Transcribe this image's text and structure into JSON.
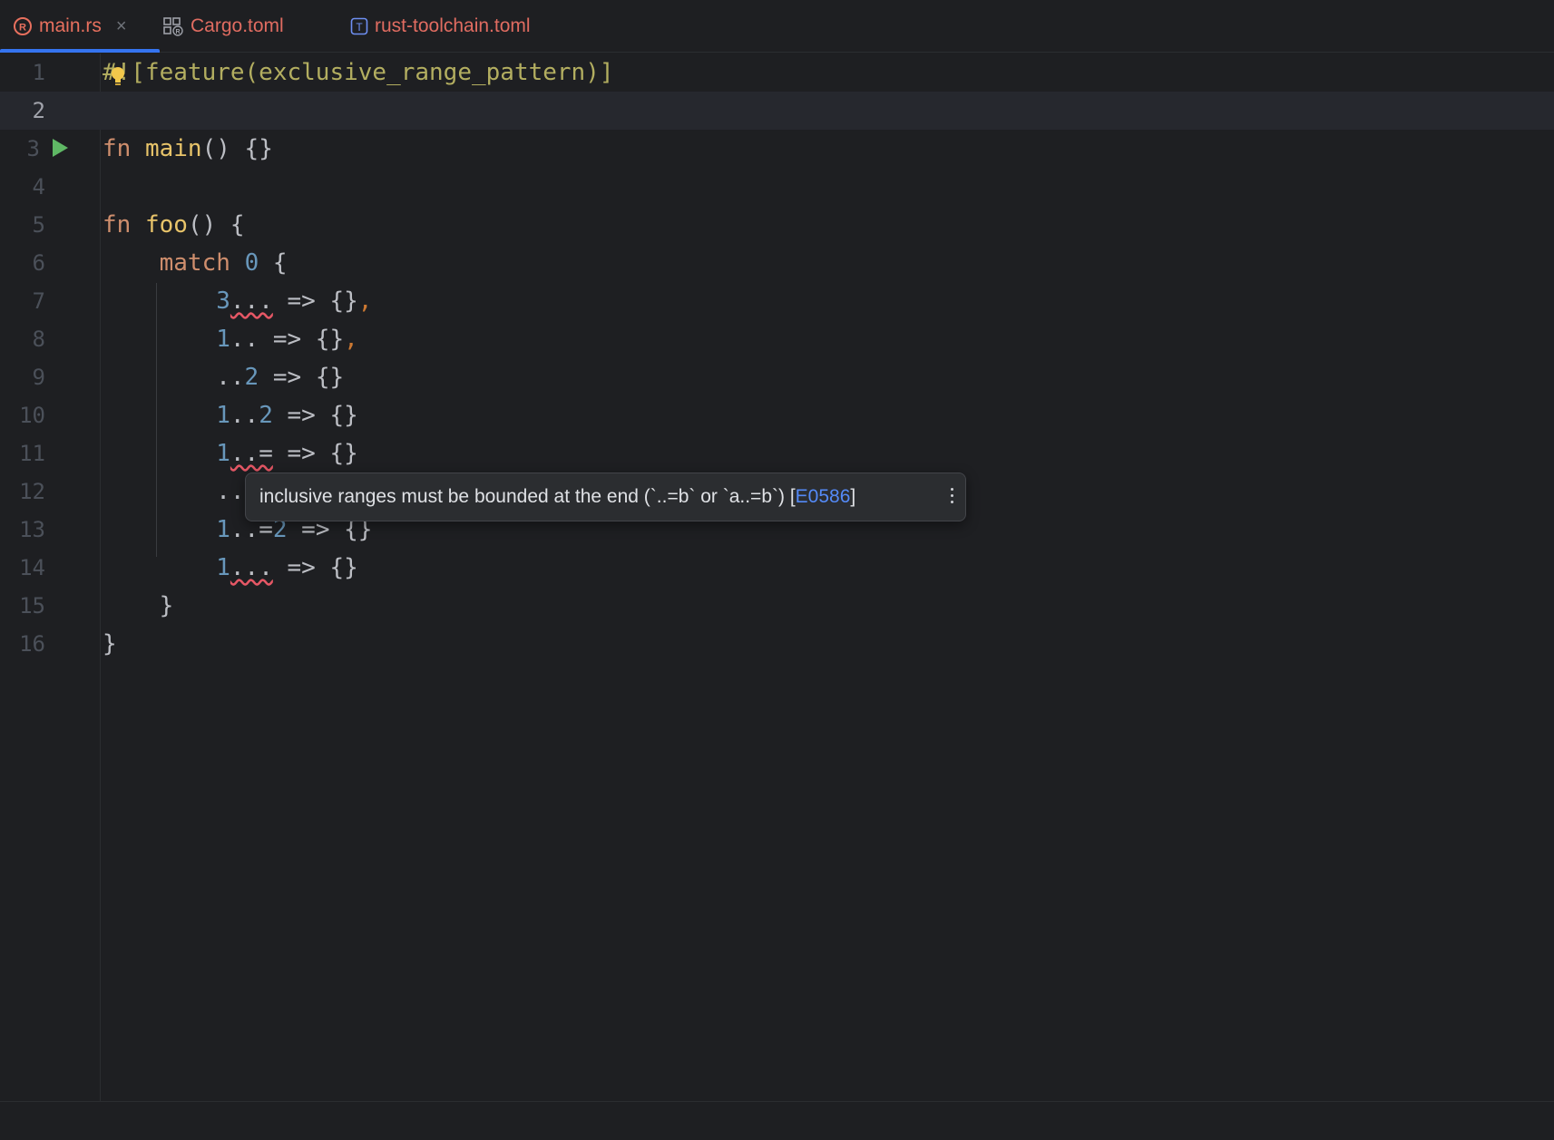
{
  "tabs": [
    {
      "label": "main.rs",
      "icon": "rust-file-icon",
      "active": true,
      "close_glyph": "×"
    },
    {
      "label": "Cargo.toml",
      "icon": "cargo-file-icon",
      "active": false
    },
    {
      "label": "rust-toolchain.toml",
      "icon": "toml-file-icon",
      "active": false
    }
  ],
  "editor": {
    "current_line": 2,
    "lines": [
      {
        "number": "1",
        "text": "#![feature(exclusive_range_pattern)]"
      },
      {
        "number": "2",
        "text": ""
      },
      {
        "number": "3",
        "text": "fn main() {}"
      },
      {
        "number": "4",
        "text": ""
      },
      {
        "number": "5",
        "text": "fn foo() {"
      },
      {
        "number": "6",
        "text": "    match 0 {"
      },
      {
        "number": "7",
        "text": "        3... => {},"
      },
      {
        "number": "8",
        "text": "        1.. => {},"
      },
      {
        "number": "9",
        "text": "        ..2 => {}"
      },
      {
        "number": "10",
        "text": "        1..2 => {}"
      },
      {
        "number": "11",
        "text": "        1..= => {}"
      },
      {
        "number": "12",
        "text": "        .."
      },
      {
        "number": "13",
        "text": "        1..=2 => {}"
      },
      {
        "number": "14",
        "text": "        1... => {}"
      },
      {
        "number": "15",
        "text": "    }"
      },
      {
        "number": "16",
        "text": "}"
      }
    ]
  },
  "tooltip": {
    "message": "inclusive ranges must be bounded at the end (`..=b` or `a..=b`) [",
    "error_code": "E0586",
    "suffix": "]",
    "more_icon": "more-vertical-icon"
  },
  "colors": {
    "background": "#1e1f22",
    "keyword": "#cf8e6d",
    "number": "#6897bb",
    "attribute": "#b3ae60",
    "accent": "#3574f0",
    "run": "#5fb865",
    "error_underline": "#e55765"
  }
}
